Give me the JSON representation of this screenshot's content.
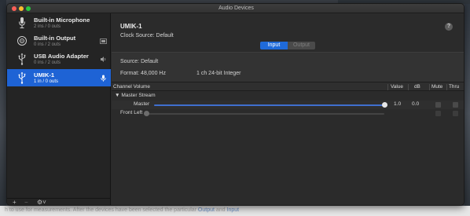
{
  "window": {
    "title": "Audio Devices"
  },
  "devices": [
    {
      "name": "Built-in Microphone",
      "sub": "2 ins / 0 outs",
      "icon": "microphone-icon",
      "selected": false
    },
    {
      "name": "Built-in Output",
      "sub": "0 ins / 2 outs",
      "icon": "speaker-icon",
      "selected": false
    },
    {
      "name": "USB Audio Adapter",
      "sub": "0 ins / 2 outs",
      "icon": "usb-icon",
      "selected": false
    },
    {
      "name": "UMIK-1",
      "sub": "1 in / 0 outs",
      "icon": "usb-icon",
      "selected": true
    }
  ],
  "sidebar_footer": {
    "add": "+",
    "remove": "−",
    "gear": "⚙˅"
  },
  "detail": {
    "name": "UMIK-1",
    "clock_source": "Clock Source:  Default",
    "help": "?",
    "tabs": [
      "Input",
      "Output"
    ],
    "active_tab": "Input",
    "source": "Source:  Default",
    "format_label": "Format:  48,000 Hz",
    "format_value": "1 ch 24-bit Integer"
  },
  "table": {
    "headers": [
      "Channel Volume",
      "Value",
      "dB",
      "Mute",
      "Thru"
    ],
    "group": "▼ Master Stream",
    "rows": [
      {
        "label": "Master",
        "level": 1.0,
        "value": "1.0",
        "db": "0.0",
        "enabled": true
      },
      {
        "label": "Front Left",
        "level": 0,
        "value": "",
        "db": "",
        "enabled": false
      }
    ]
  },
  "background": {
    "bottom_text_a": "h to use for measurements. After the devices have been selected the particular ",
    "bottom_link_a": "Output",
    "bottom_text_b": " and ",
    "bottom_link_b": "Input"
  },
  "colors": {
    "accent": "#1e63d5",
    "window_bg": "#2b2b2b",
    "sidebar_bg": "#242424"
  }
}
